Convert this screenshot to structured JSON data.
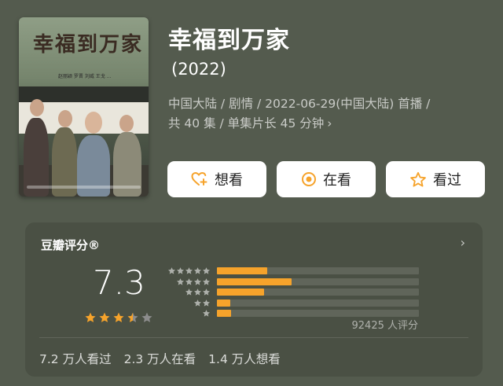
{
  "title": "幸福到万家",
  "year": "(2022)",
  "meta": {
    "line1": "中国大陆 / 剧情 / 2022-06-29(中国大陆) 首播 /",
    "line2": "共 40 集 / 单集片长 45 分钟"
  },
  "poster": {
    "title_art": "幸福到万家",
    "credits": "赵丽颖 罗晋 刘威 王戈 …"
  },
  "actions": [
    {
      "label": "想看",
      "icon": "heart-plus-icon"
    },
    {
      "label": "在看",
      "icon": "target-icon"
    },
    {
      "label": "看过",
      "icon": "star-outline-icon"
    }
  ],
  "rating": {
    "header": "豆瓣评分®",
    "score": "7.3",
    "stars_value": 3.5,
    "distribution": [
      {
        "stars": 5,
        "fraction": 0.25
      },
      {
        "stars": 4,
        "fraction": 0.37
      },
      {
        "stars": 3,
        "fraction": 0.235
      },
      {
        "stars": 2,
        "fraction": 0.065
      },
      {
        "stars": 1,
        "fraction": 0.07
      }
    ],
    "votes": "92425 人评分",
    "stats": [
      "7.2 万人看过",
      "2.3 万人在看",
      "1.4 万人想看"
    ]
  },
  "colors": {
    "background": "#545b4e",
    "card": "#4a5044",
    "accent": "#f6a32b",
    "star_empty": "#8c8c8c"
  }
}
